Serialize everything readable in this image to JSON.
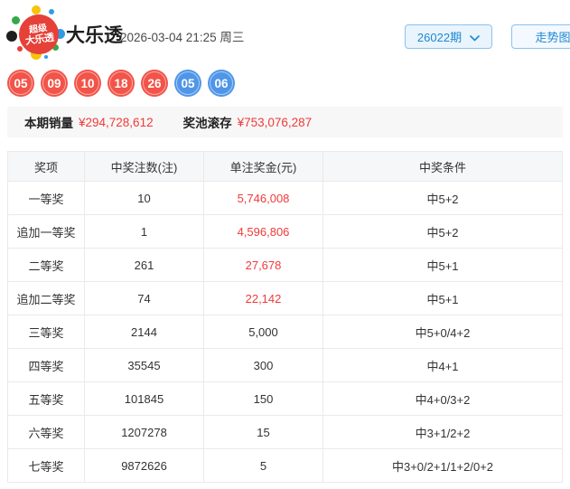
{
  "header": {
    "logo_lines": [
      "超级",
      "大乐透"
    ],
    "title": "大乐透",
    "datetime": "2026-03-04 21:25 周三",
    "issue_select": "26022期",
    "trend_button": "走势图"
  },
  "draw": {
    "front_numbers": [
      "05",
      "09",
      "10",
      "18",
      "26"
    ],
    "back_numbers": [
      "05",
      "06"
    ]
  },
  "summary": {
    "sales_label": "本期销量",
    "sales_value": "¥294,728,612",
    "pool_label": "奖池滚存",
    "pool_value": "¥753,076,287"
  },
  "prize_table": {
    "headers": [
      "奖项",
      "中奖注数(注)",
      "单注奖金(元)",
      "中奖条件"
    ],
    "rows": [
      {
        "name": "一等奖",
        "count": "10",
        "prize": "5,746,008",
        "prize_red": true,
        "condition": "中5+2"
      },
      {
        "name": "追加一等奖",
        "count": "1",
        "prize": "4,596,806",
        "prize_red": true,
        "condition": "中5+2"
      },
      {
        "name": "二等奖",
        "count": "261",
        "prize": "27,678",
        "prize_red": true,
        "condition": "中5+1"
      },
      {
        "name": "追加二等奖",
        "count": "74",
        "prize": "22,142",
        "prize_red": true,
        "condition": "中5+1"
      },
      {
        "name": "三等奖",
        "count": "2144",
        "prize": "5,000",
        "prize_red": false,
        "condition": "中5+0/4+2"
      },
      {
        "name": "四等奖",
        "count": "35545",
        "prize": "300",
        "prize_red": false,
        "condition": "中4+1"
      },
      {
        "name": "五等奖",
        "count": "101845",
        "prize": "150",
        "prize_red": false,
        "condition": "中4+0/3+2"
      },
      {
        "name": "六等奖",
        "count": "1207278",
        "prize": "15",
        "prize_red": false,
        "condition": "中3+1/2+2"
      },
      {
        "name": "七等奖",
        "count": "9872626",
        "prize": "5",
        "prize_red": false,
        "condition": "中3+0/2+1/1+2/0+2"
      }
    ]
  },
  "colors": {
    "front_ball": "#f25449",
    "back_ball": "#5096e8",
    "accent_red": "#f13a3a",
    "accent_blue": "#1e88d2"
  }
}
